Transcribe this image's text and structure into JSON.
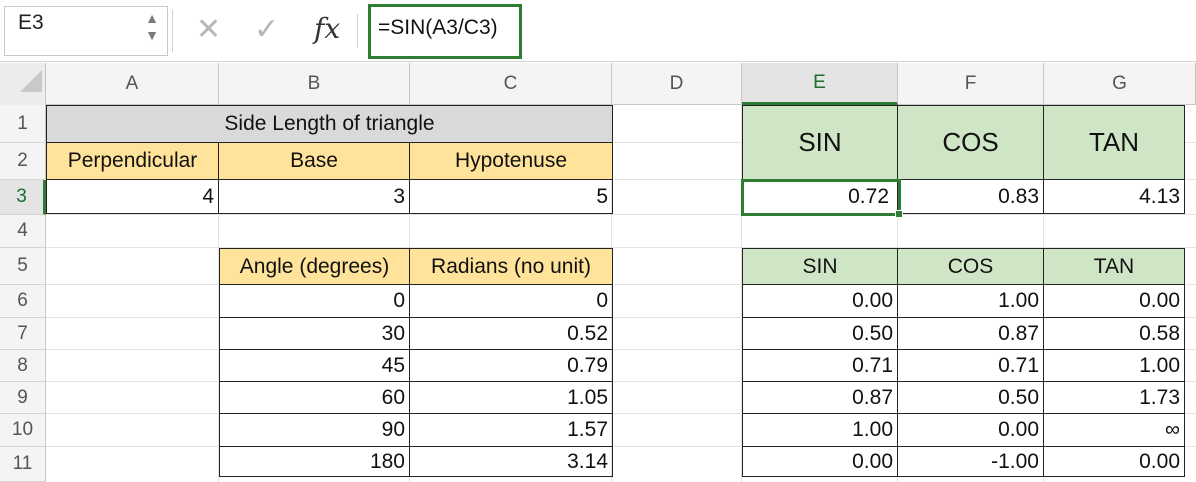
{
  "formula_bar": {
    "name_box": "E3",
    "cancel_icon": "✕",
    "enter_icon": "✓",
    "fx_label": "fx",
    "formula": "=SIN(A3/C3)"
  },
  "columns": [
    "A",
    "B",
    "C",
    "D",
    "E",
    "F",
    "G"
  ],
  "rows": [
    "1",
    "2",
    "3",
    "4",
    "5",
    "6",
    "7",
    "8",
    "9",
    "10",
    "11"
  ],
  "selection": {
    "cell": "E3",
    "column": "E",
    "row": "3",
    "accent": "#2e7d32"
  },
  "colors": {
    "header_gray": "#d9d9d9",
    "yellow": "#ffe39a",
    "green": "#cfe6c6"
  },
  "sheet": {
    "triangle_title": "Side Length of triangle",
    "triangle_headers": [
      "Perpendicular",
      "Base",
      "Hypotenuse"
    ],
    "triangle_values": [
      "4",
      "3",
      "5"
    ],
    "angle_headers": [
      "Angle (degrees)",
      "Radians (no unit)"
    ],
    "angle_rows": [
      [
        "0",
        "0"
      ],
      [
        "30",
        "0.52"
      ],
      [
        "45",
        "0.79"
      ],
      [
        "60",
        "1.05"
      ],
      [
        "90",
        "1.57"
      ],
      [
        "180",
        "3.14"
      ]
    ],
    "trig_headers_top": [
      "SIN",
      "COS",
      "TAN"
    ],
    "trig_values_top": [
      "0.72",
      "0.83",
      "4.13"
    ],
    "trig_headers": [
      "SIN",
      "COS",
      "TAN"
    ],
    "trig_rows": [
      [
        "0.00",
        "1.00",
        "0.00"
      ],
      [
        "0.50",
        "0.87",
        "0.58"
      ],
      [
        "0.71",
        "0.71",
        "1.00"
      ],
      [
        "0.87",
        "0.50",
        "1.73"
      ],
      [
        "1.00",
        "0.00",
        "∞"
      ],
      [
        "0.00",
        "-1.00",
        "0.00"
      ]
    ]
  }
}
